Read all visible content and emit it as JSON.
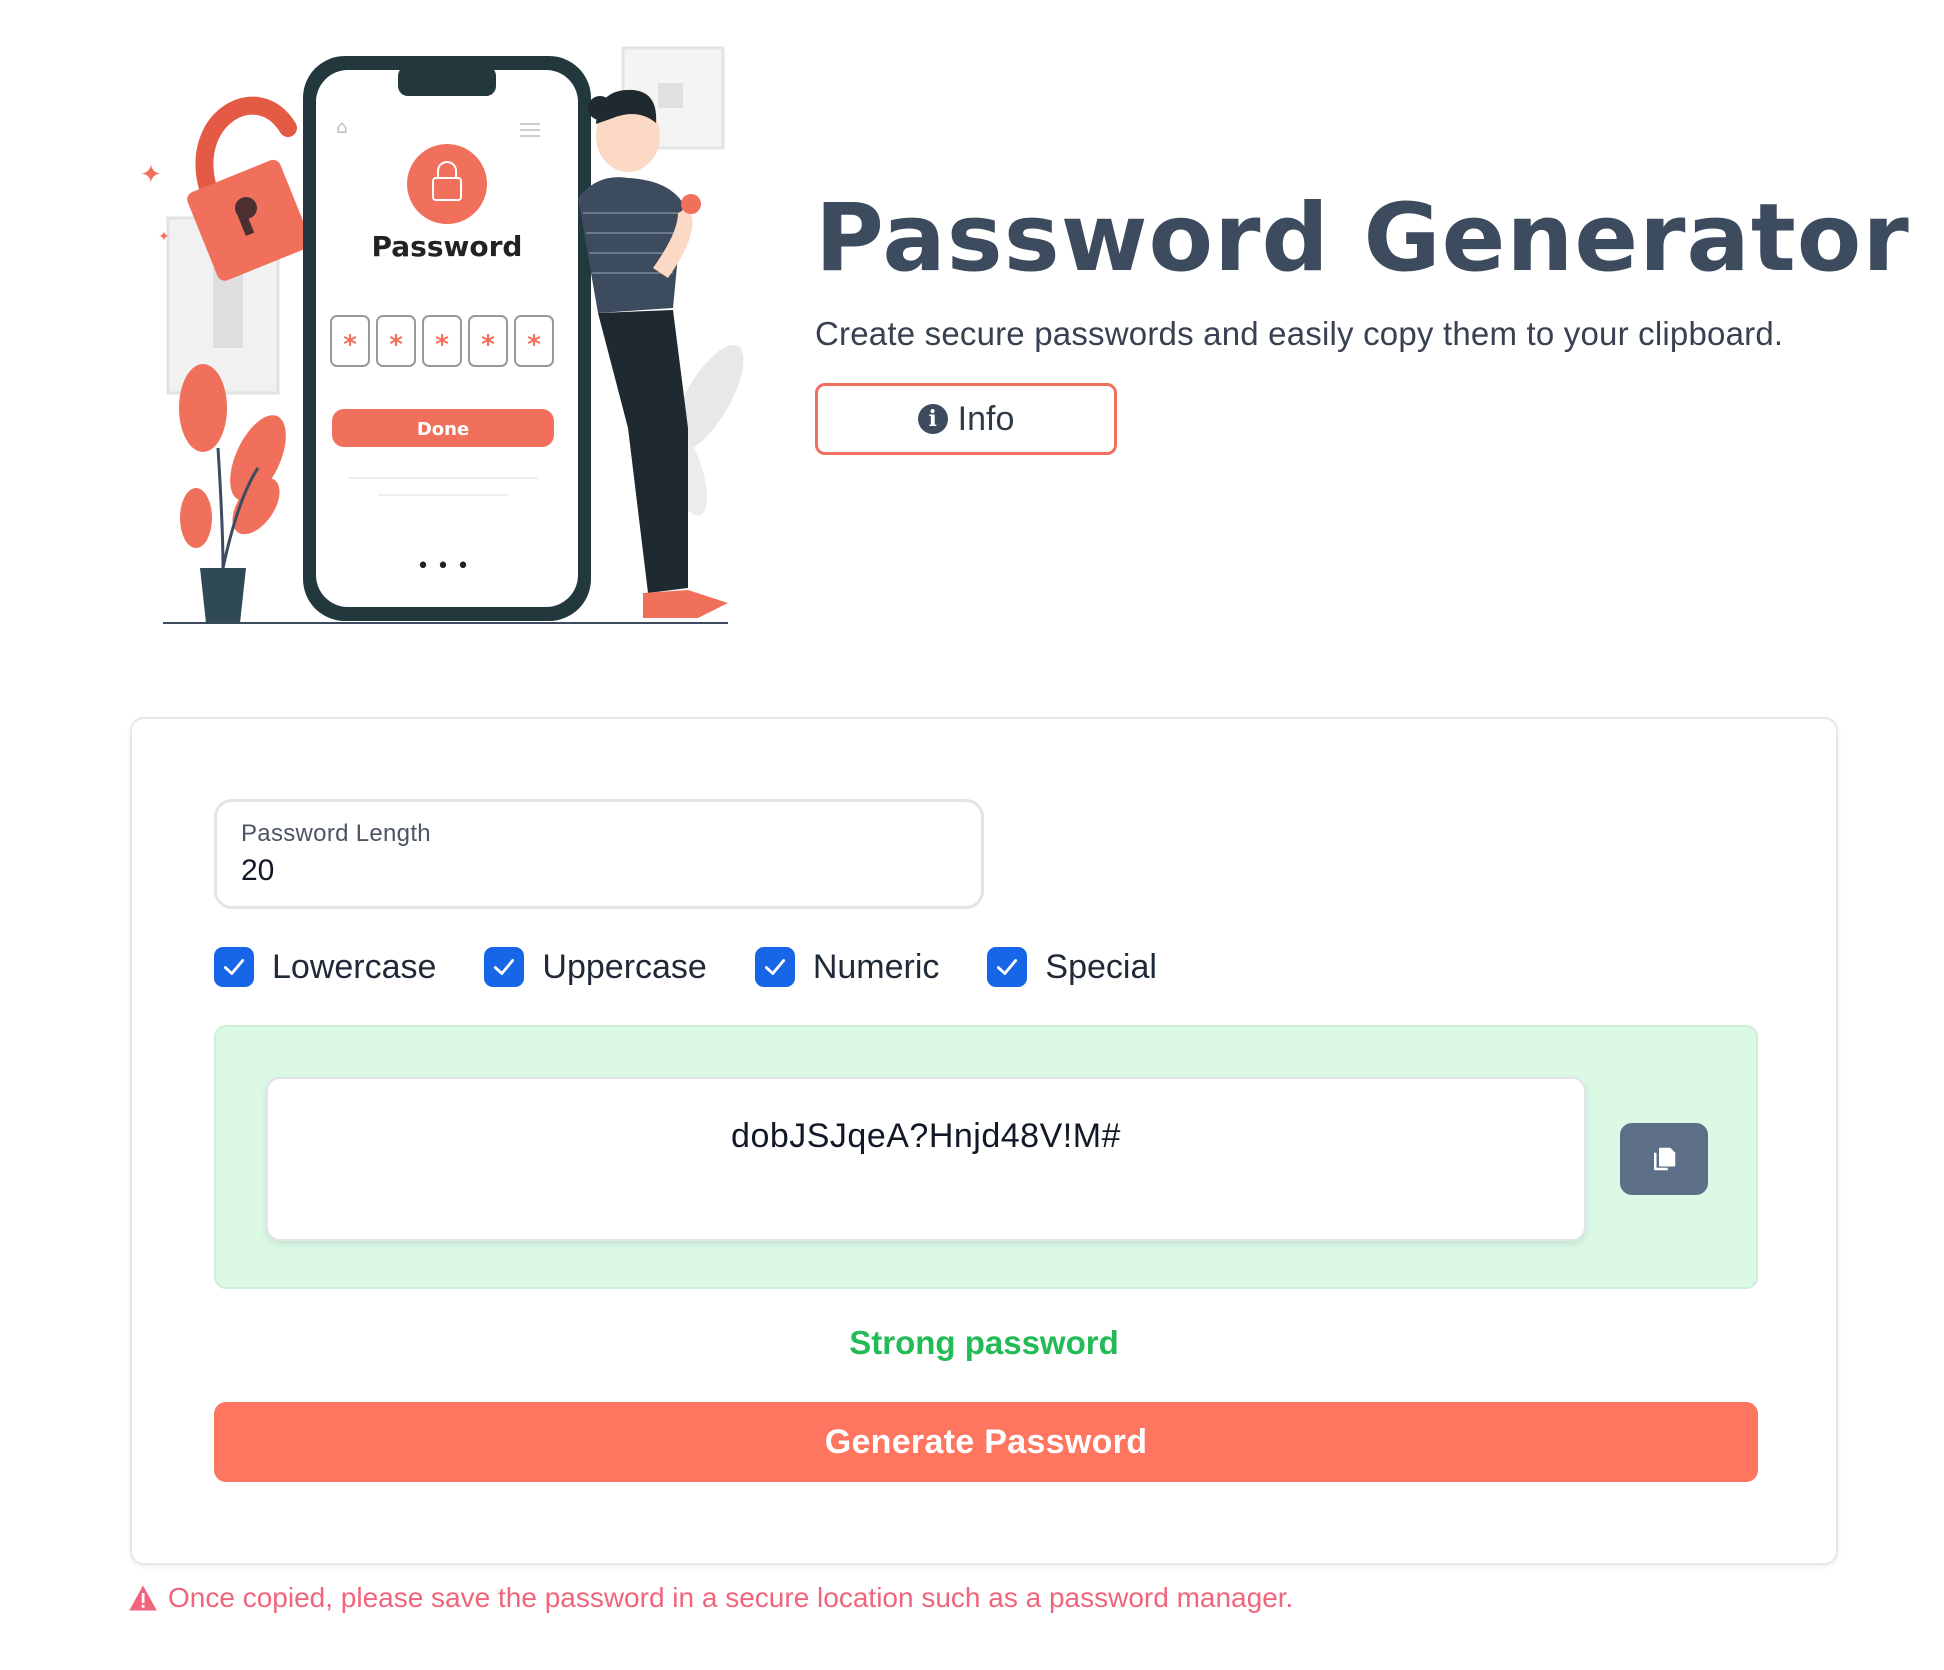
{
  "hero": {
    "title": "Password Generator",
    "subtitle": "Create secure passwords and easily copy them to your clipboard.",
    "info_button": "Info",
    "illustration": {
      "phone_title": "Password",
      "phone_button": "Done",
      "mask_char": "*",
      "phone_dots": "• • •"
    }
  },
  "form": {
    "length_label": "Password Length",
    "length_value": "20",
    "options": [
      {
        "label": "Lowercase",
        "checked": true
      },
      {
        "label": "Uppercase",
        "checked": true
      },
      {
        "label": "Numeric",
        "checked": true
      },
      {
        "label": "Special",
        "checked": true
      }
    ]
  },
  "result": {
    "password": "dobJSJqeA?Hnjd48V!M#",
    "copy_icon": "copy-icon",
    "strength": "Strong password"
  },
  "generate_button": "Generate Password",
  "warning": "Once copied, please save the password in a secure location such as a password manager.",
  "colors": {
    "accent": "#fe7560",
    "checkbox": "#1766e8",
    "strength": "#22bb55",
    "result_bg": "#dcf9e6",
    "warning": "#f1657c",
    "title": "#3d4b5e"
  }
}
